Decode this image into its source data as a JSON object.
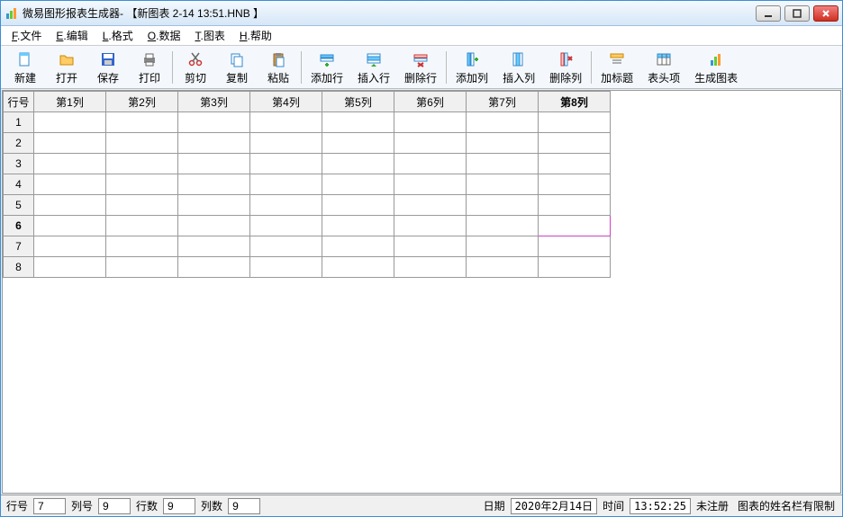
{
  "window": {
    "title": "微易图形报表生成器- 【新图表 2-14 13:51.HNB 】"
  },
  "menu": {
    "file": "文件",
    "edit": "编辑",
    "format": "格式",
    "data": "数据",
    "chart": "图表",
    "help": "帮助",
    "file_u": "F",
    "edit_u": "E",
    "format_u": "L",
    "data_u": "O",
    "chart_u": "T",
    "help_u": "H"
  },
  "toolbar": [
    {
      "name": "new-button",
      "label": "新建",
      "icon": "new"
    },
    {
      "name": "open-button",
      "label": "打开",
      "icon": "open"
    },
    {
      "name": "save-button",
      "label": "保存",
      "icon": "save"
    },
    {
      "name": "print-button",
      "label": "打印",
      "icon": "print"
    },
    {
      "sep": true
    },
    {
      "name": "cut-button",
      "label": "剪切",
      "icon": "cut"
    },
    {
      "name": "copy-button",
      "label": "复制",
      "icon": "copy"
    },
    {
      "name": "paste-button",
      "label": "粘贴",
      "icon": "paste"
    },
    {
      "sep": true
    },
    {
      "name": "add-row-button",
      "label": "添加行",
      "icon": "addrow"
    },
    {
      "name": "insert-row-button",
      "label": "插入行",
      "icon": "insrow"
    },
    {
      "name": "delete-row-button",
      "label": "删除行",
      "icon": "delrow"
    },
    {
      "sep": true
    },
    {
      "name": "add-col-button",
      "label": "添加列",
      "icon": "addcol"
    },
    {
      "name": "insert-col-button",
      "label": "插入列",
      "icon": "inscol"
    },
    {
      "name": "delete-col-button",
      "label": "删除列",
      "icon": "delcol"
    },
    {
      "sep": true
    },
    {
      "name": "add-title-button",
      "label": "加标题",
      "icon": "title"
    },
    {
      "name": "header-item-button",
      "label": "表头项",
      "icon": "header"
    },
    {
      "name": "gen-chart-button",
      "label": "生成图表",
      "icon": "chart"
    }
  ],
  "grid": {
    "rowheader_label": "行号",
    "columns": [
      "第1列",
      "第2列",
      "第3列",
      "第4列",
      "第5列",
      "第6列",
      "第7列",
      "第8列"
    ],
    "rows": [
      "1",
      "2",
      "3",
      "4",
      "5",
      "6",
      "7",
      "8"
    ],
    "selected_row": 6,
    "selected_col": 8
  },
  "status": {
    "row_label": "行号",
    "row_val": "7",
    "col_label": "列号",
    "col_val": "9",
    "rows_label": "行数",
    "rows_val": "9",
    "cols_label": "列数",
    "cols_val": "9",
    "date_label": "日期",
    "date_val": "2020年2月14日",
    "time_label": "时间",
    "time_val": "13:52:25",
    "reg": "未注册",
    "note": "图表的姓名栏有限制"
  }
}
